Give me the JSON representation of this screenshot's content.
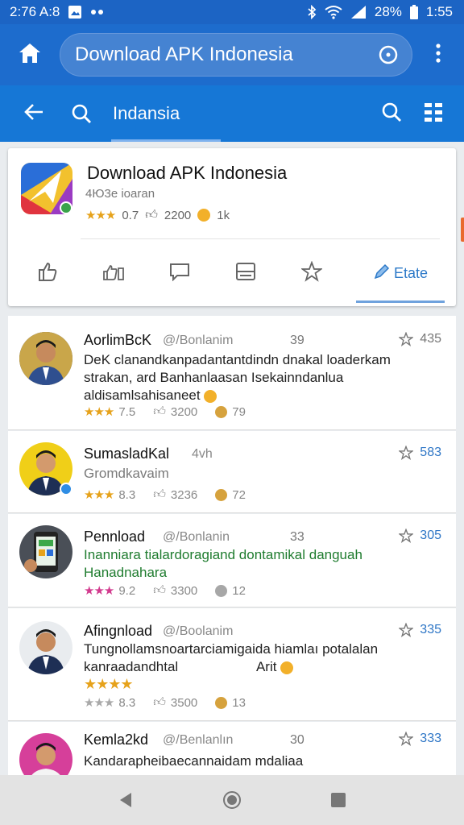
{
  "status_bar": {
    "time_left": "2:76 A:8",
    "battery": "28%",
    "time_right": "1:55"
  },
  "app_bar": {
    "title": "Download APK Indonesia"
  },
  "search_bar": {
    "query": "Indansia"
  },
  "app_card": {
    "title": "Download APK Indonesia",
    "subtitle": "4Ю3e ioaran",
    "rating": "0.7",
    "likes": "2200",
    "count": "1k",
    "rate_label": "Etate"
  },
  "reviews": [
    {
      "name": "AorlimBcK",
      "handle": "@/Bonlanim",
      "num": "39",
      "favs": "435",
      "text": "DeK clanandkanpadantantdindn dnakal loaderkam strakan, ard Banhanlaasan Isekainndanlua aldisamlsahisaneet",
      "rating": "7.5",
      "likes": "3200",
      "count": "79"
    },
    {
      "name": "SumasladKal",
      "handle": "4vh",
      "num": "",
      "favs": "583",
      "text": "Gromdkavaim",
      "rating": "8.3",
      "likes": "3236",
      "count": "72"
    },
    {
      "name": "Pennload",
      "handle": "@/Bonlanin",
      "num": "33",
      "favs": "305",
      "text": "Inanniara tialardoragiand dontamikal danguah Hanadnahara",
      "rating": "9.2",
      "likes": "3300",
      "count": "12"
    },
    {
      "name": "Afingnload",
      "handle": "@/Boolanim",
      "num": "",
      "favs": "335",
      "text": "Tungnollamsnoartarciamigaida hiamlaı potalalan kanraadandhtal",
      "extra": "Arit",
      "rating": "8.3",
      "likes": "3500",
      "count": "13"
    },
    {
      "name": "Kemla2kd",
      "handle": "@/Benlanlın",
      "num": "30",
      "favs": "333",
      "text": "Kandarapheibaecannaidam mdaliaa"
    }
  ]
}
